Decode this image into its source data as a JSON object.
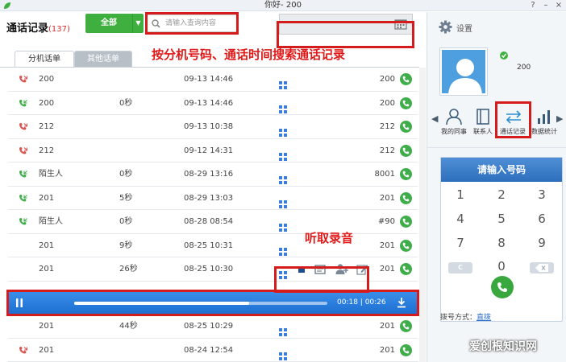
{
  "window": {
    "title": "你好- 200"
  },
  "header": {
    "title": "通话记录",
    "count": "(137)",
    "filter_label": "全部",
    "search_placeholder": "请输入查询内容"
  },
  "annotations": {
    "search_note": "按分机号码、通话时间搜索通话记录",
    "record_note": "听取录音"
  },
  "tabs": [
    {
      "label": "分机话单"
    },
    {
      "label": "其他话单"
    }
  ],
  "rows": [
    {
      "type": "missed",
      "number": "200",
      "duration": "",
      "time": "09-13 14:46",
      "ext": "200"
    },
    {
      "type": "incoming",
      "number": "200",
      "duration": "0秒",
      "time": "09-13 14:46",
      "ext": "200"
    },
    {
      "type": "missed",
      "number": "212",
      "duration": "",
      "time": "09-13 10:38",
      "ext": "212"
    },
    {
      "type": "missed",
      "number": "212",
      "duration": "",
      "time": "09-12 14:31",
      "ext": "212"
    },
    {
      "type": "incoming",
      "number": "陌生人",
      "duration": "0秒",
      "time": "08-29 13:16",
      "ext": "8001"
    },
    {
      "type": "incoming",
      "number": "201",
      "duration": "5秒",
      "time": "08-29 13:03",
      "ext": "201"
    },
    {
      "type": "incoming",
      "number": "陌生人",
      "duration": "0秒",
      "time": "08-28 08:54",
      "ext": "#90"
    },
    {
      "type": "none",
      "number": "201",
      "duration": "9秒",
      "time": "08-25 10:31",
      "ext": "201"
    },
    {
      "type": "none",
      "number": "201",
      "duration": "26秒",
      "time": "08-25 10:30",
      "ext": "201"
    },
    {
      "type": "none",
      "number": "201",
      "duration": "44秒",
      "time": "08-25 10:29",
      "ext": "201"
    },
    {
      "type": "missed",
      "number": "201",
      "duration": "",
      "time": "08-24 12:54",
      "ext": "201"
    }
  ],
  "player": {
    "time": "00:18 | 00:26",
    "progress": 0.69
  },
  "sidebar": {
    "settings_label": "设置",
    "user_ext": "200",
    "nav": [
      {
        "label": "我的同事"
      },
      {
        "label": "联系人"
      },
      {
        "label": "通话记录"
      },
      {
        "label": "数据统计"
      }
    ]
  },
  "dialpad": {
    "title": "请输入号码",
    "keys": [
      "1",
      "2",
      "3",
      "4",
      "5",
      "6",
      "7",
      "8",
      "9",
      "0"
    ],
    "clear_label": "C",
    "mode_label": "拨号方式：",
    "mode_value": "直拨"
  },
  "watermark": "爱创根知识网",
  "colors": {
    "accent_green": "#3fb03f",
    "accent_blue": "#1d6fd1",
    "annotation_red": "#e01919"
  }
}
